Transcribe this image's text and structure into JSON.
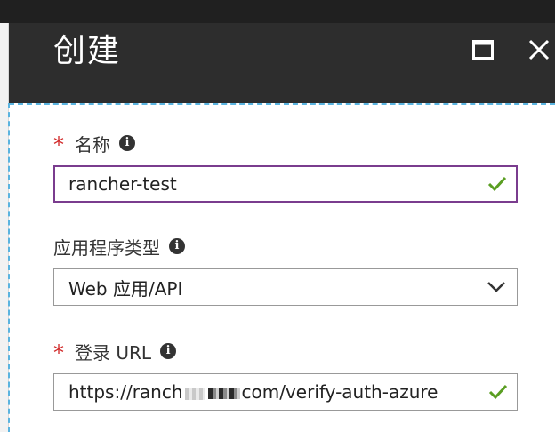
{
  "blade": {
    "title": "创建"
  },
  "form": {
    "name": {
      "required_mark": "*",
      "label": "名称",
      "value": "rancher-test",
      "valid": true
    },
    "app_type": {
      "label": "应用程序类型",
      "selected": "Web 应用/API"
    },
    "sign_on_url": {
      "required_mark": "*",
      "label": "登录 URL",
      "value_prefix": "https://ranch",
      "value_suffix": "com/verify-auth-azure",
      "valid": true
    }
  },
  "colors": {
    "header_bg": "#2d2d2d",
    "focus_border": "#7a3c8e",
    "required": "#d12a2a",
    "valid_check": "#5a9e22",
    "selection_dash": "#5ab4e0"
  },
  "icons": {
    "info": "info-icon",
    "maximize": "maximize-icon",
    "close": "close-icon",
    "valid": "checkmark-icon",
    "dropdown": "chevron-down-icon"
  }
}
